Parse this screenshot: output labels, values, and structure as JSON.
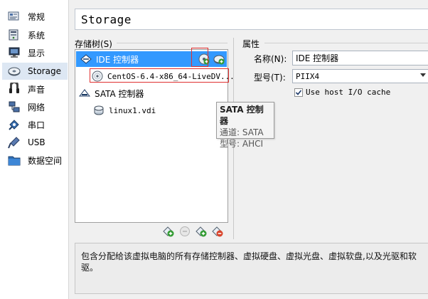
{
  "sidebar": {
    "items": [
      {
        "label": "常规",
        "icon": "general-icon"
      },
      {
        "label": "系统",
        "icon": "system-icon"
      },
      {
        "label": "显示",
        "icon": "display-icon"
      },
      {
        "label": "Storage",
        "icon": "storage-icon",
        "selected": true
      },
      {
        "label": "声音",
        "icon": "audio-icon"
      },
      {
        "label": "网络",
        "icon": "network-icon"
      },
      {
        "label": "串口",
        "icon": "serial-port-icon"
      },
      {
        "label": "USB",
        "icon": "usb-icon"
      },
      {
        "label": "数据空间",
        "icon": "shared-folders-icon"
      }
    ]
  },
  "header": {
    "title": "Storage"
  },
  "storage_tree": {
    "label": "存储树(S)",
    "items": [
      {
        "type": "controller",
        "label": "IDE 控制器",
        "selected": true
      },
      {
        "type": "attachment",
        "label": "CentOS-6.4-x86_64-LiveDV..."
      },
      {
        "type": "controller",
        "label": "SATA 控制器"
      },
      {
        "type": "attachment",
        "label": "linux1.vdi"
      }
    ]
  },
  "attributes": {
    "label": "属性",
    "name_label": "名称(N):",
    "name_value": "IDE 控制器",
    "type_label": "型号(T):",
    "type_value": "PIIX4",
    "cache_label": "Use host I/O cache",
    "cache_checked": true
  },
  "tooltip": {
    "title": "SATA 控制器",
    "port_line": "通道: SATA",
    "type_line": "型号: AHCI"
  },
  "description": "包含分配给该虚拟电脑的所有存储控制器、虚拟硬盘、虚拟光盘、虚拟软盘,以及光驱和软驱。",
  "colors": {
    "selection": "#3399ff",
    "highlight_box": "#e03030",
    "sidebar_selected": "#dde7f3"
  }
}
